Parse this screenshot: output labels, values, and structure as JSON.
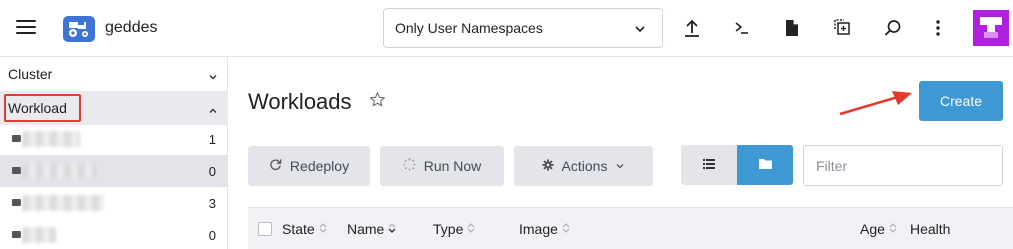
{
  "header": {
    "menu_icon": "hamburger-menu-icon",
    "logo_icon": "tractor-icon",
    "cluster_name": "geddes",
    "namespace_select": {
      "value": "Only User Namespaces",
      "icon": "chevron-down-icon"
    },
    "icons": [
      "upload-icon",
      "terminal-icon",
      "file-icon",
      "copy-config-icon",
      "search-icon",
      "kebab-menu-icon"
    ],
    "avatar_color": "#b020e0"
  },
  "sidebar": {
    "groups": [
      {
        "label": "Cluster",
        "expanded": false
      },
      {
        "label": "Workload",
        "expanded": true
      }
    ],
    "items": [
      {
        "label_obscured": true,
        "count": "1"
      },
      {
        "label_obscured": true,
        "count": "0"
      },
      {
        "label_obscured": true,
        "count": "3"
      },
      {
        "label_obscured": true,
        "count": "0"
      }
    ],
    "annotation_color": "#e23a2e"
  },
  "main": {
    "title": "Workloads",
    "create_label": "Create",
    "buttons": {
      "redeploy": "Redeploy",
      "run_now": "Run Now",
      "actions": "Actions"
    },
    "filter_placeholder": "Filter",
    "columns": [
      "State",
      "Name",
      "Type",
      "Image",
      "Age",
      "Health"
    ]
  },
  "colors": {
    "accent": "#3d98d3",
    "button_gray": "#e3e5ea",
    "annotation_red": "#e23a2e"
  }
}
